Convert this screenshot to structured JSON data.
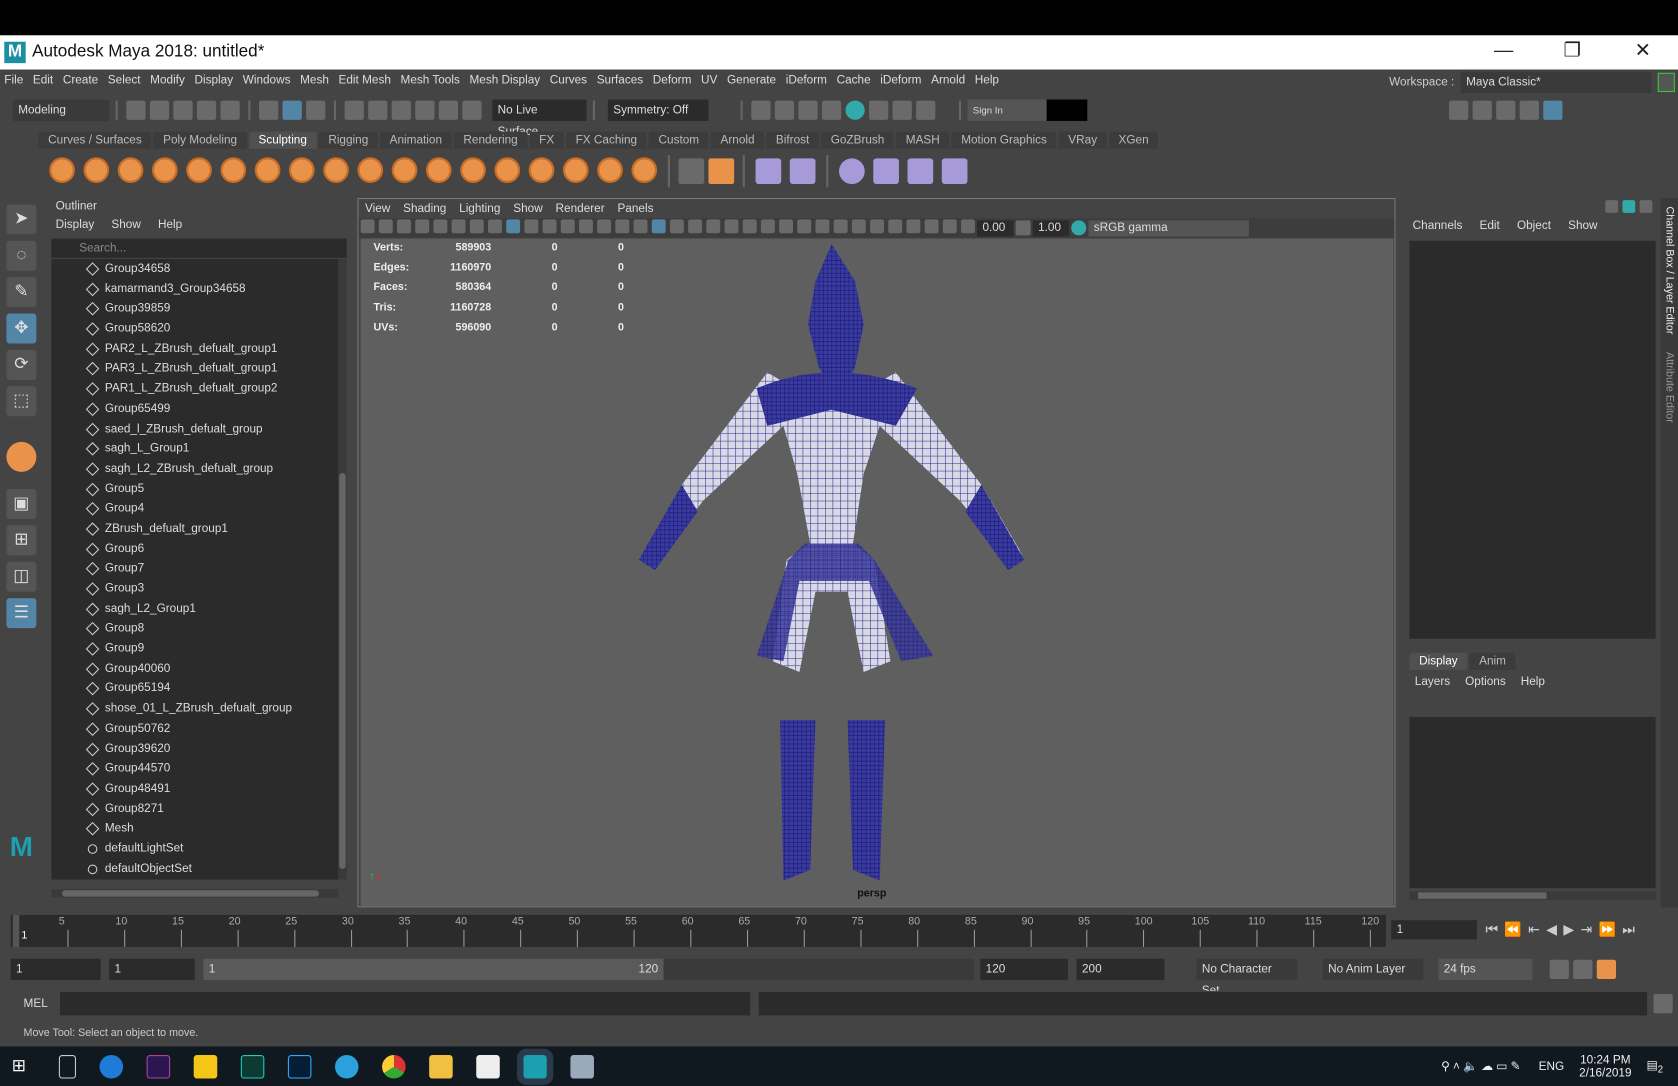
{
  "window": {
    "title": "Autodesk Maya 2018: untitled*",
    "logo": "M",
    "minimize": "—",
    "restore": "❐",
    "close": "✕"
  },
  "menubar": [
    "File",
    "Edit",
    "Create",
    "Select",
    "Modify",
    "Display",
    "Windows",
    "Mesh",
    "Edit Mesh",
    "Mesh Tools",
    "Mesh Display",
    "Curves",
    "Surfaces",
    "Deform",
    "UV",
    "Generate",
    "iDeform",
    "Cache",
    "iDeform",
    "Arnold",
    "Help"
  ],
  "workspace": {
    "label": "Workspace :",
    "value": "Maya Classic*"
  },
  "statusline": {
    "mode": "Modeling",
    "live_surface": "No Live Surface",
    "symmetry": "Symmetry: Off",
    "sign_in": "Sign In"
  },
  "shelf_tabs": [
    "Curves / Surfaces",
    "Poly Modeling",
    "Sculpting",
    "Rigging",
    "Animation",
    "Rendering",
    "FX",
    "FX Caching",
    "Custom",
    "Arnold",
    "Bifrost",
    "GoZBrush",
    "MASH",
    "Motion Graphics",
    "VRay",
    "XGen"
  ],
  "shelf_active": "Sculpting",
  "outliner": {
    "title": "Outliner",
    "menu": [
      "Display",
      "Show",
      "Help"
    ],
    "search_placeholder": "Search...",
    "items": [
      "Group34658",
      "kamarmand3_Group34658",
      "Group39859",
      "Group58620",
      "PAR2_L_ZBrush_defualt_group1",
      "PAR3_L_ZBrush_defualt_group1",
      "PAR1_L_ZBrush_defualt_group2",
      "Group65499",
      "saed_l_ZBrush_defualt_group",
      "sagh_L_Group1",
      "sagh_L2_ZBrush_defualt_group",
      "Group5",
      "Group4",
      "ZBrush_defualt_group1",
      "Group6",
      "Group7",
      "Group3",
      "sagh_L2_Group1",
      "Group8",
      "Group9",
      "Group40060",
      "Group65194",
      "shose_01_L_ZBrush_defualt_group",
      "Group50762",
      "Group39620",
      "Group44570",
      "Group48491",
      "Group8271",
      "Mesh",
      "defaultLightSet",
      "defaultObjectSet"
    ]
  },
  "viewport": {
    "menu": [
      "View",
      "Shading",
      "Lighting",
      "Show",
      "Renderer",
      "Panels"
    ],
    "exposure": "0.00",
    "gamma": "1.00",
    "color_space": "sRGB gamma",
    "camera": "persp",
    "stats": [
      {
        "k": "Verts:",
        "v": "589903",
        "a": "0",
        "b": "0"
      },
      {
        "k": "Edges:",
        "v": "1160970",
        "a": "0",
        "b": "0"
      },
      {
        "k": "Faces:",
        "v": "580364",
        "a": "0",
        "b": "0"
      },
      {
        "k": "Tris:",
        "v": "1160728",
        "a": "0",
        "b": "0"
      },
      {
        "k": "UVs:",
        "v": "596090",
        "a": "0",
        "b": "0"
      }
    ]
  },
  "channelbox": {
    "menu": [
      "Channels",
      "Edit",
      "Object",
      "Show"
    ],
    "side_tabs": [
      "Channel Box / Layer Editor",
      "Attribute Editor"
    ]
  },
  "layer_editor": {
    "tabs": [
      "Display",
      "Anim"
    ],
    "menu": [
      "Layers",
      "Options",
      "Help"
    ]
  },
  "timeline": {
    "ticks": [
      "5",
      "10",
      "15",
      "20",
      "25",
      "30",
      "35",
      "40",
      "45",
      "50",
      "55",
      "60",
      "65",
      "70",
      "75",
      "80",
      "85",
      "90",
      "95",
      "100",
      "105",
      "110",
      "115",
      "120"
    ],
    "start_marker": "1",
    "current_frame": "1"
  },
  "range": {
    "start": "1",
    "playback_start": "1",
    "slider_start": "1",
    "slider_end": "120",
    "playback_end": "120",
    "end": "200",
    "character_set": "No Character Set",
    "anim_layer": "No Anim Layer",
    "fps": "24 fps"
  },
  "mel": {
    "label": "MEL"
  },
  "help_line": "Move Tool: Select an object to move.",
  "taskbar": {
    "lang": "ENG",
    "time": "10:24 PM",
    "date": "2/16/2019",
    "notifications": "2"
  }
}
